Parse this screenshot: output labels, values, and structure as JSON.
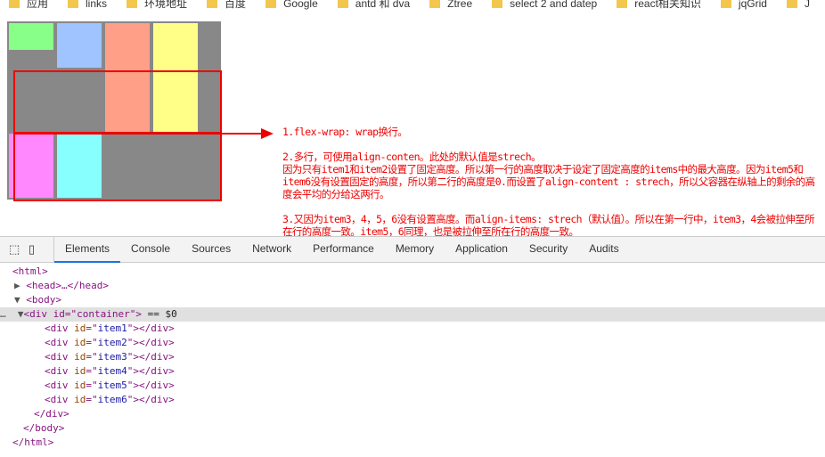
{
  "bookmarks": [
    "应用",
    "links",
    "环境地址",
    "百度",
    "Google",
    "antd 和 dva",
    "Ztree",
    "select 2  and datep",
    "react相关知识",
    "jqGrid",
    "J"
  ],
  "colors": {
    "container": "#888888",
    "item1": "#88ff88",
    "item2": "#a0c4ff",
    "item3": "#ff9f88",
    "item4": "#ffff88",
    "item5": "#ff88ff",
    "item6": "#88ffff",
    "annotation": "#ee0000"
  },
  "notes": [
    "1.flex-wrap: wrap换行。",
    "2.多行，可使用align-conten。此处的默认值是strech。\n因为只有item1和item2设置了固定高度。所以第一行的高度取决于设定了固定高度的items中的最大高度。因为item5和item6没有设置固定的高度，所以第二行的高度是0.而设置了align-content : strech，所以父容器在纵轴上的剩余的高度会平均的分给这两行。",
    "3.又因为item3，4，5，6没有设置高度。而align-items: strech（默认值）。所以在第一行中，item3，4会被拉伸至所在行的高度一致。item5，6同理，也是被拉伸至所在行的高度一致。"
  ],
  "devtools": {
    "tabs": [
      "Elements",
      "Console",
      "Sources",
      "Network",
      "Performance",
      "Memory",
      "Application",
      "Security",
      "Audits"
    ],
    "tree": {
      "html_open": "<html>",
      "head": "<head>…</head>",
      "body_open": "<body>",
      "container_open": "<div id=\"container\">",
      "selected_marker": "== $0",
      "items": [
        "item1",
        "item2",
        "item3",
        "item4",
        "item5",
        "item6"
      ],
      "div_close": "</div>",
      "body_close": "</body>",
      "html_close": "</html>"
    }
  }
}
